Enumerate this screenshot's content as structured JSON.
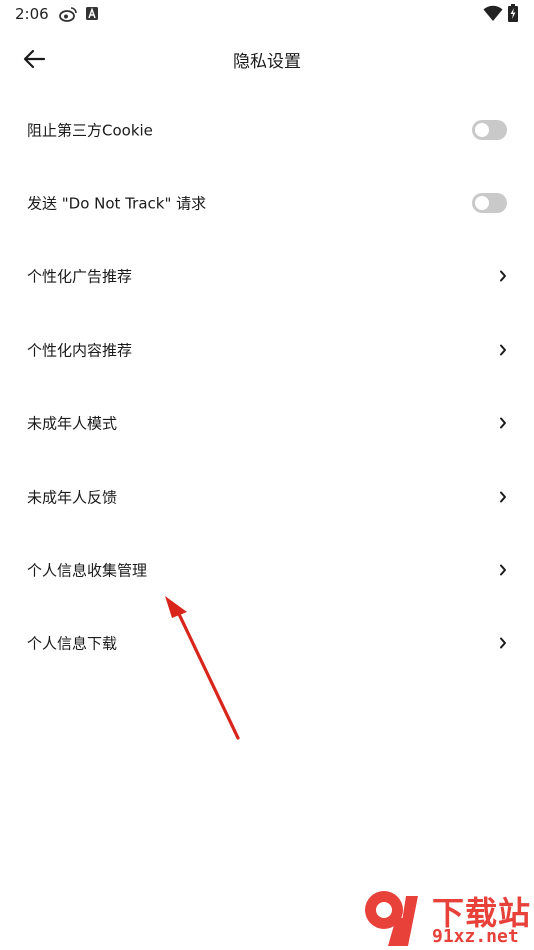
{
  "status_bar": {
    "time": "2:06",
    "icons": [
      "weibo-icon",
      "a-icon",
      "wifi-icon",
      "battery-charging-icon"
    ]
  },
  "header": {
    "title": "隐私设置",
    "back_icon": "arrow-left-icon"
  },
  "settings": [
    {
      "label": "阻止第三方Cookie",
      "control": "toggle",
      "on": false
    },
    {
      "label": "发送 \"Do Not Track\" 请求",
      "control": "toggle",
      "on": false
    },
    {
      "label": "个性化广告推荐",
      "control": "chevron"
    },
    {
      "label": "个性化内容推荐",
      "control": "chevron"
    },
    {
      "label": "未成年人模式",
      "control": "chevron"
    },
    {
      "label": "未成年人反馈",
      "control": "chevron"
    },
    {
      "label": "个人信息收集管理",
      "control": "chevron"
    },
    {
      "label": "个人信息下载",
      "control": "chevron"
    }
  ],
  "colors": {
    "toggle_off": "#c9c9c9",
    "annotation_arrow": "#d9261c",
    "watermark": "#e8413a"
  },
  "watermark": {
    "title": "下载站",
    "url": "91xz.net"
  }
}
